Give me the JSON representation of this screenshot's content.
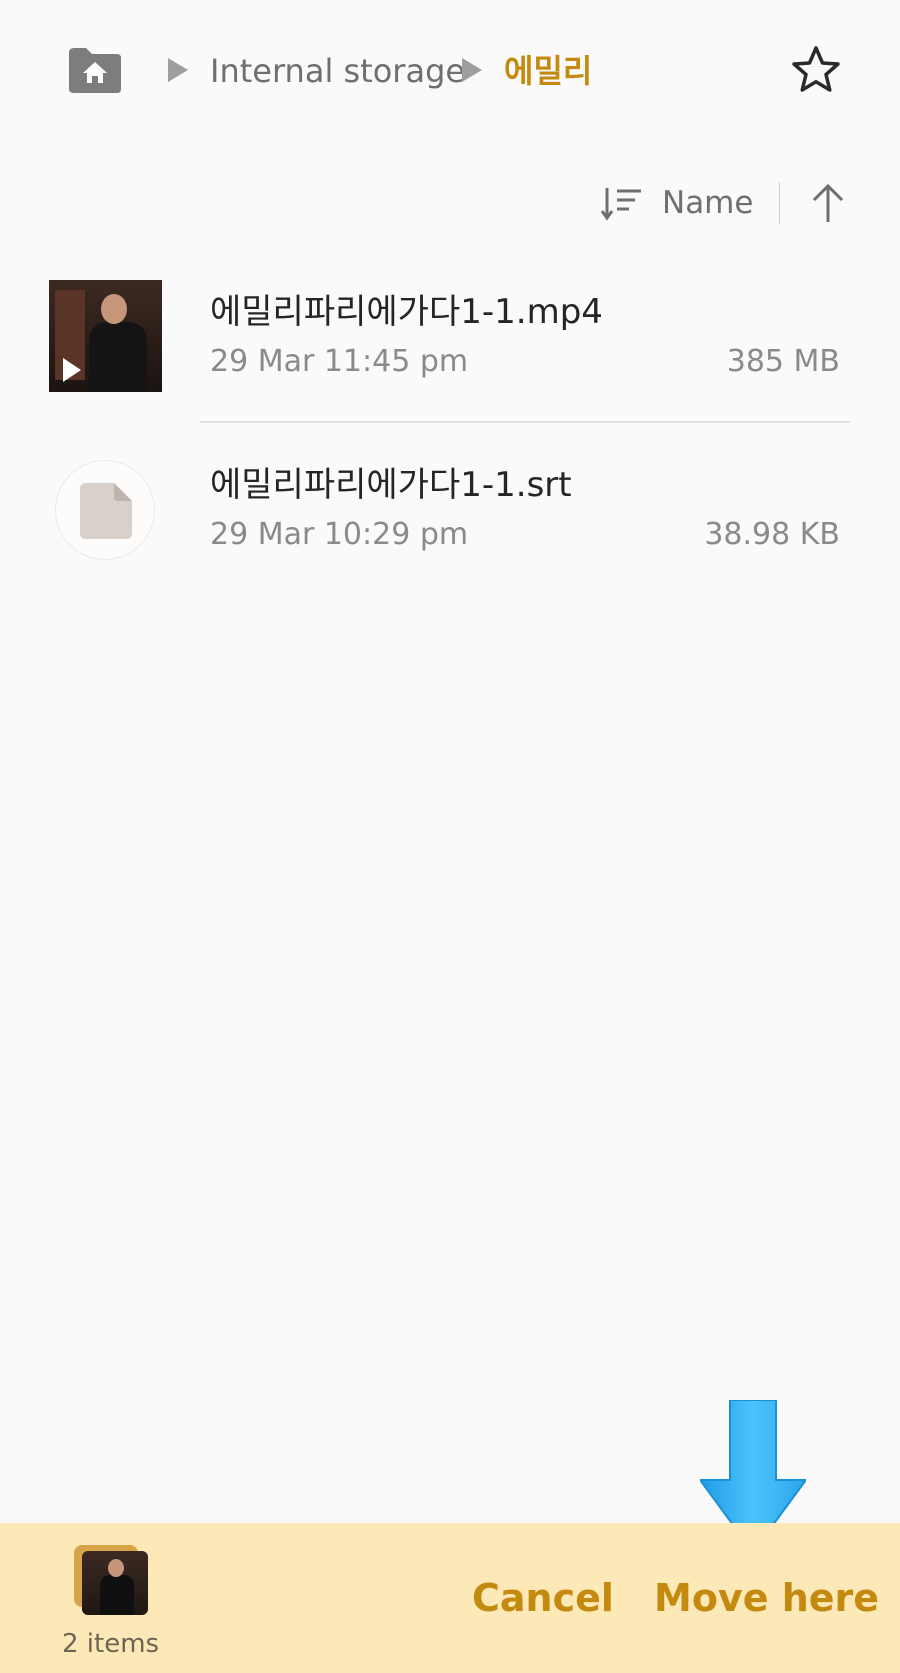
{
  "breadcrumb": {
    "root": "Internal storage",
    "current": "에밀리"
  },
  "sort": {
    "label": "Name"
  },
  "files": [
    {
      "name": "에밀리파리에가다1-1.mp4",
      "date": "29 Mar 11:45 pm",
      "size": "385 MB",
      "type": "video"
    },
    {
      "name": "에밀리파리에가다1-1.srt",
      "date": "29 Mar 10:29 pm",
      "size": "38.98 KB",
      "type": "document"
    }
  ],
  "bottom_bar": {
    "items_count": "2 items",
    "cancel_label": "Cancel",
    "move_label": "Move here"
  },
  "colors": {
    "accent": "#c4890f",
    "bottom_bar_bg": "#fde9b7",
    "background": "#fafafa",
    "overlay_arrow": "#39b4f4"
  },
  "icons": {
    "home": "home-folder-icon",
    "breadcrumb_separator": "triangle-right-icon",
    "favorite": "star-outline-icon",
    "sort": "sort-lines-icon",
    "sort_direction": "arrow-up-icon",
    "video_play": "play-icon",
    "document": "document-icon",
    "overlay": "arrow-down-icon"
  }
}
